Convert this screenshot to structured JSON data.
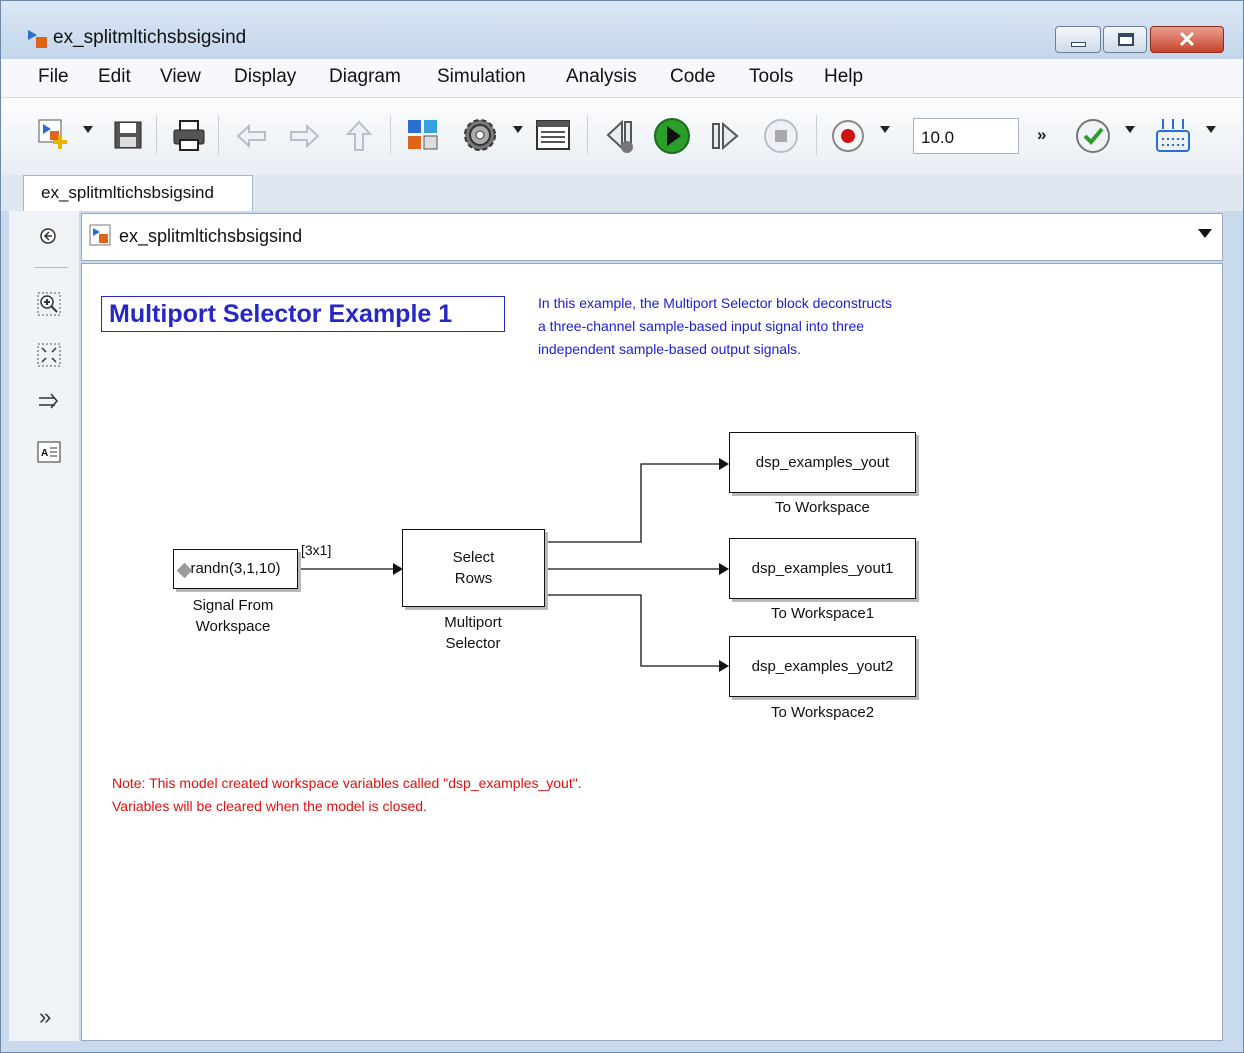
{
  "window": {
    "title": "ex_splitmltichsbsigsind"
  },
  "menu": {
    "items": [
      "File",
      "Edit",
      "View",
      "Display",
      "Diagram",
      "Simulation",
      "Analysis",
      "Code",
      "Tools",
      "Help"
    ]
  },
  "toolbar": {
    "stop_time_value": "10.0",
    "more_label": "»"
  },
  "tab": {
    "label": "ex_splitmltichsbsigsind"
  },
  "address": {
    "path": "ex_splitmltichsbsigsind"
  },
  "model": {
    "title": "Multiport Selector Example 1",
    "description": [
      "In this example, the Multiport Selector block deconstructs",
      "a three-channel sample-based input signal into three",
      "independent sample-based output signals."
    ],
    "note": [
      "Note: This model created workspace variables called \"dsp_examples_yout\".",
      "Variables will be cleared when the model is closed."
    ],
    "signal_dimension": "[3x1]",
    "blocks": {
      "source": {
        "text": "randn(3,1,10)",
        "label_line1": "Signal From",
        "label_line2": "Workspace"
      },
      "selector": {
        "text_line1": "Select",
        "text_line2": "Rows",
        "label_line1": "Multiport",
        "label_line2": "Selector"
      },
      "out1": {
        "text": "dsp_examples_yout",
        "label": "To Workspace"
      },
      "out2": {
        "text": "dsp_examples_yout1",
        "label": "To Workspace1"
      },
      "out3": {
        "text": "dsp_examples_yout2",
        "label": "To Workspace2"
      }
    }
  },
  "icons": {
    "left_pane": [
      "back-icon",
      "zoom-in-icon",
      "fit-to-view-icon",
      "signal-lines-icon",
      "annotation-icon",
      "expand-icon"
    ],
    "toolbar": [
      "new-model-icon",
      "save-icon",
      "print-icon",
      "back-arrow-icon",
      "forward-arrow-icon",
      "up-arrow-icon",
      "library-browser-icon",
      "model-settings-icon",
      "model-explorer-icon",
      "step-back-icon",
      "run-icon",
      "step-forward-icon",
      "stop-icon",
      "record-icon",
      "check-icon",
      "hardware-icon"
    ]
  },
  "colors": {
    "annotation_blue": "#2727c8",
    "note_red": "#e01010",
    "run_green": "#2a9d2a",
    "record_red": "#d01010"
  }
}
